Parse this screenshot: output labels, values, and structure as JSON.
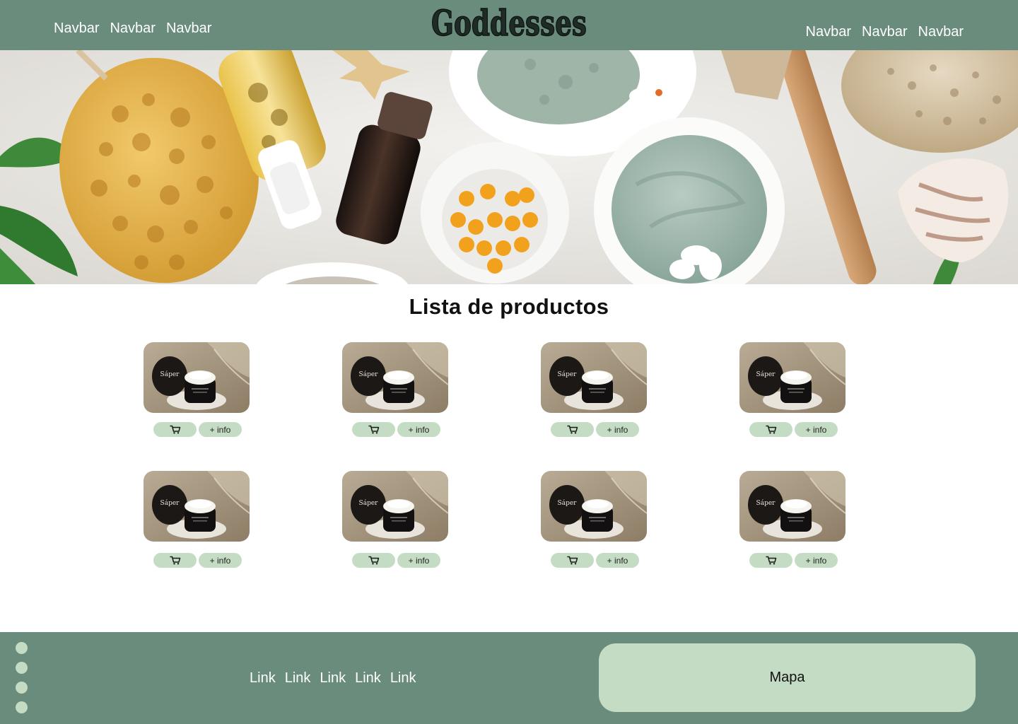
{
  "header": {
    "brand": "Goddesses",
    "nav_left": [
      "Navbar",
      "Navbar",
      "Navbar"
    ],
    "nav_right": [
      "Navbar",
      "Navbar",
      "Navbar"
    ]
  },
  "hero": {
    "icon": "spa-products-photo"
  },
  "products": {
    "title": "Lista de productos",
    "image_brand": "Sáper",
    "cart_icon": "cart-icon",
    "info_label": "+ info"
  },
  "footer": {
    "social_icons": [
      "social-icon",
      "social-icon",
      "social-icon",
      "social-icon"
    ],
    "links": [
      "Link",
      "Link",
      "Link",
      "Link",
      "Link"
    ],
    "map_label": "Mapa"
  },
  "colors": {
    "header_bg": "#6a8c7d",
    "accent_light": "#c4dcc4",
    "text_light": "#ffffff"
  }
}
